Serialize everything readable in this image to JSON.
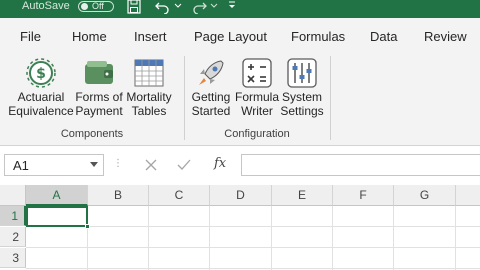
{
  "titlebar": {
    "autosave_label": "AutoSave",
    "autosave_state": "Off",
    "background": "#217346"
  },
  "tabs": [
    "File",
    "Home",
    "Insert",
    "Page Layout",
    "Formulas",
    "Data",
    "Review"
  ],
  "ribbon": {
    "groups": [
      {
        "label": "Components",
        "buttons": [
          {
            "label": "Actuarial\nEquivalence",
            "icon": "actuarial-equivalence-icon"
          },
          {
            "label": "Forms of\nPayment",
            "icon": "wallet-icon"
          },
          {
            "label": "Mortality\nTables",
            "icon": "table-grid-icon"
          }
        ]
      },
      {
        "label": "Configuration",
        "buttons": [
          {
            "label": "Getting\nStarted",
            "icon": "rocket-icon"
          },
          {
            "label": "Formula\nWriter",
            "icon": "calculator-icon"
          },
          {
            "label": "System\nSettings",
            "icon": "sliders-icon"
          }
        ]
      }
    ]
  },
  "formula_bar": {
    "name_box": "A1",
    "fx_label": "fx",
    "formula": ""
  },
  "grid": {
    "columns": [
      "A",
      "B",
      "C",
      "D",
      "E",
      "F",
      "G"
    ],
    "rows": [
      "1",
      "2",
      "3"
    ],
    "active_cell": "A1",
    "accent": "#217346"
  }
}
